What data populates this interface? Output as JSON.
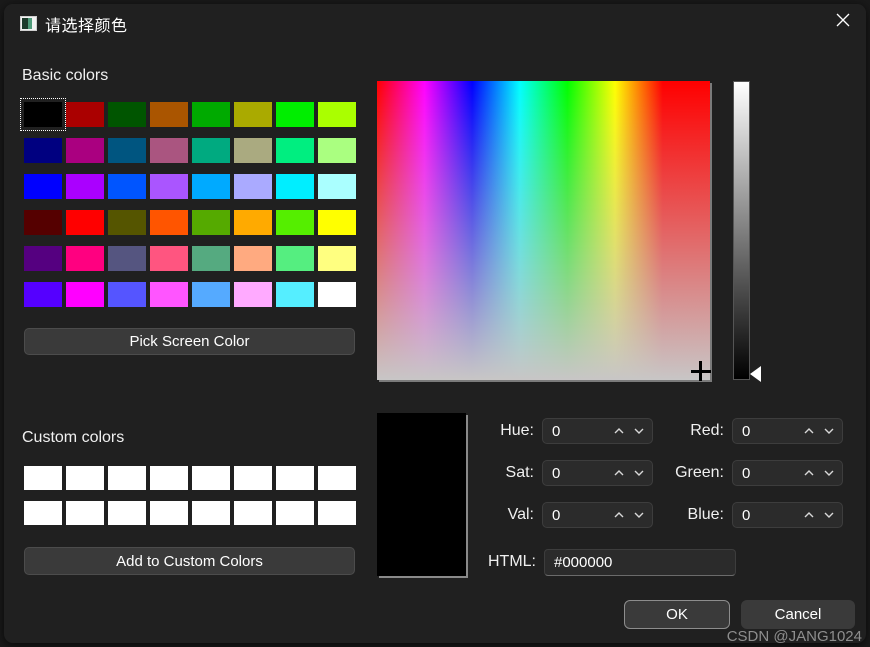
{
  "window": {
    "title": "请选择颜色",
    "icon": "color-palette-icon",
    "close_icon": "close-icon",
    "background": "#202020"
  },
  "basic_colors": {
    "label": "Basic colors",
    "selected_index": 0,
    "swatches": [
      "#000000",
      "#aa0000",
      "#005500",
      "#aa5500",
      "#00aa00",
      "#aaaa00",
      "#00ee00",
      "#aaff00",
      "#000080",
      "#aa0080",
      "#005580",
      "#aa5580",
      "#00aa80",
      "#aaaa80",
      "#00ee80",
      "#aaff80",
      "#0000ff",
      "#aa00ff",
      "#0055ff",
      "#aa55ff",
      "#00aaff",
      "#aaaaff",
      "#00eeff",
      "#aaffff",
      "#550000",
      "#ff0000",
      "#555500",
      "#ff5500",
      "#55aa00",
      "#ffaa00",
      "#55ee00",
      "#ffff00",
      "#550080",
      "#ff0080",
      "#555580",
      "#ff5580",
      "#55aa80",
      "#ffaa80",
      "#55ee80",
      "#ffff80",
      "#5500ff",
      "#ff00ff",
      "#5555ff",
      "#ff55ff",
      "#55aaff",
      "#ffaaff",
      "#55eeff",
      "#ffffff"
    ]
  },
  "pick_screen_color": {
    "label": "Pick Screen Color"
  },
  "custom_colors": {
    "label": "Custom colors",
    "swatches": [
      "#ffffff",
      "#ffffff",
      "#ffffff",
      "#ffffff",
      "#ffffff",
      "#ffffff",
      "#ffffff",
      "#ffffff",
      "#ffffff",
      "#ffffff",
      "#ffffff",
      "#ffffff",
      "#ffffff",
      "#ffffff",
      "#ffffff",
      "#ffffff"
    ]
  },
  "add_custom_colors": {
    "label": "Add to Custom Colors"
  },
  "picker": {
    "cursor_position": "bottom-right",
    "value_slider_position": "bottom"
  },
  "preview": {
    "color": "#000000"
  },
  "fields": {
    "hue": {
      "label": "Hue:",
      "value": "0"
    },
    "sat": {
      "label": "Sat:",
      "value": "0"
    },
    "val": {
      "label": "Val:",
      "value": "0"
    },
    "red": {
      "label": "Red:",
      "value": "0"
    },
    "green": {
      "label": "Green:",
      "value": "0"
    },
    "blue": {
      "label": "Blue:",
      "value": "0"
    },
    "html": {
      "label": "HTML:",
      "value": "#000000"
    }
  },
  "buttons": {
    "ok": "OK",
    "cancel": "Cancel"
  },
  "watermark": "CSDN @JANG1024"
}
